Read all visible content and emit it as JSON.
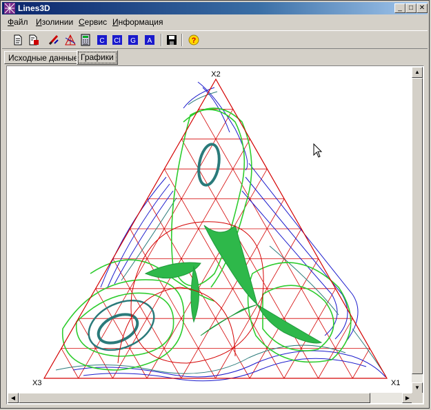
{
  "window": {
    "title": "Lines3D"
  },
  "title_buttons": {
    "minimize": "_",
    "maximize": "□",
    "close": "✕"
  },
  "menu": [
    {
      "label": "Файл",
      "accel": "Ф",
      "rest": "айл"
    },
    {
      "label": "Изолинии",
      "accel": "И",
      "rest": "золинии"
    },
    {
      "label": "Сервис",
      "accel": "С",
      "rest": "ервис"
    },
    {
      "label": "Информация",
      "accel": "И",
      "rest": "нформация"
    }
  ],
  "toolbar": {
    "icons": [
      "new-document-icon",
      "open-document-icon",
      "edit-brush-icon",
      "grid-icon",
      "calculator-icon",
      "isoline-1-icon",
      "isoline-2-icon",
      "isoline-3-icon",
      "isoline-4-icon",
      "save-icon",
      "help-icon"
    ]
  },
  "tabs": [
    {
      "label": "Исходные данные",
      "active": false
    },
    {
      "label": "Графики",
      "active": true
    }
  ],
  "plot": {
    "vertex_labels": {
      "top": "X2",
      "left": "X3",
      "right": "X1"
    },
    "colors": {
      "grid": "#d40000",
      "blue": "#1a1acc",
      "teal": "#2a7a7a",
      "green": "#2ecc2e"
    }
  }
}
